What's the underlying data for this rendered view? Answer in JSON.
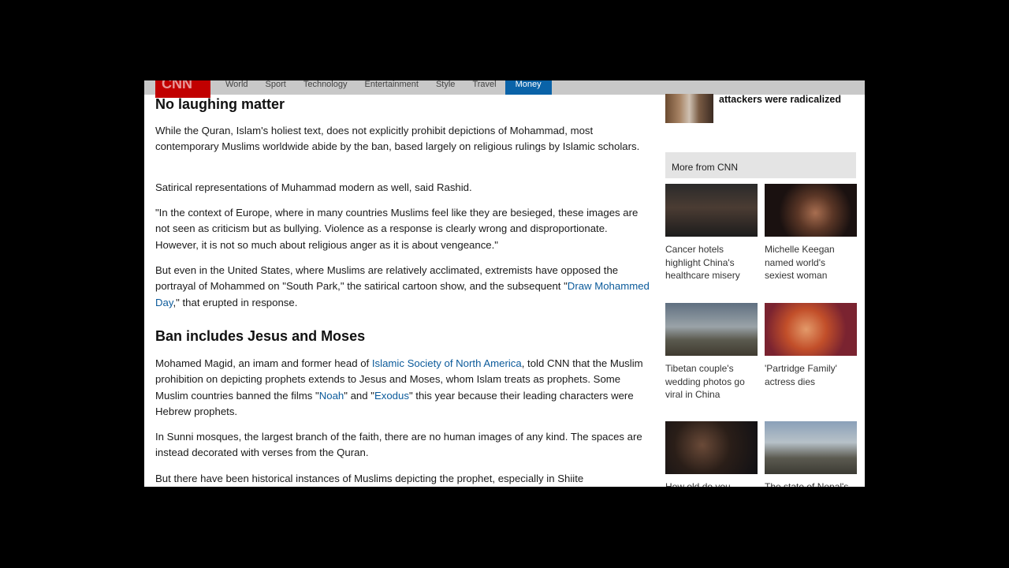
{
  "nav": {
    "logo": "CNN",
    "items": [
      "World",
      "Sport",
      "Technology",
      "Entertainment",
      "Style",
      "Travel",
      "Money"
    ],
    "active": "Money"
  },
  "article": {
    "heading1": "No laughing matter",
    "p1": "While the Quran, Islam's holiest text, does not explicitly prohibit depictions of Mohammad, most contemporary Muslims worldwide abide by the ban, based largely on religious rulings by Islamic scholars.",
    "p2": "Satirical representations of Muhammad modern as well, said Rashid.",
    "p3": "\"In the context of Europe, where in many countries Muslims feel like they are besieged, these images are not seen as criticism but as bullying. Violence as a response is clearly wrong and disproportionate. However, it is not so much about religious anger as it is about vengeance.\"",
    "p4_a": "But even in the United States, where Muslims are relatively acclimated, extremists have opposed the portrayal of Mohammed on \"South Park,\" the satirical cartoon show, and the subsequent \"",
    "p4_link": "Draw Mohammed Day",
    "p4_b": ",\" that erupted in response.",
    "heading2": "Ban includes Jesus and Moses",
    "p5_a": "Mohamed Magid, an imam and former head of ",
    "p5_link1": "Islamic Society of North America",
    "p5_b": ", told CNN that the Muslim prohibition on depicting prophets extends to Jesus and Moses, whom Islam treats as prophets. Some Muslim countries banned the films \"",
    "p5_link2": "Noah",
    "p5_c": "\" and \"",
    "p5_link3": "Exodus",
    "p5_d": "\" this year because their leading characters were Hebrew prophets.",
    "p6": "In Sunni mosques, the largest branch of the faith, there are no human images of any kind. The spaces are instead decorated with verses from the Quran.",
    "p7": "But there have been historical instances of Muslims depicting the prophet, especially in Shiite"
  },
  "rail": {
    "top_headline": "attackers were radicalized",
    "more_header": "More from CNN",
    "cards": [
      "Cancer hotels highlight China's healthcare misery",
      "Michelle Keegan named world's sexiest woman",
      "Tibetan couple's wedding photos go viral in China",
      "'Partridge Family' actress dies",
      "How old do you",
      "The state of Nepal's"
    ]
  }
}
